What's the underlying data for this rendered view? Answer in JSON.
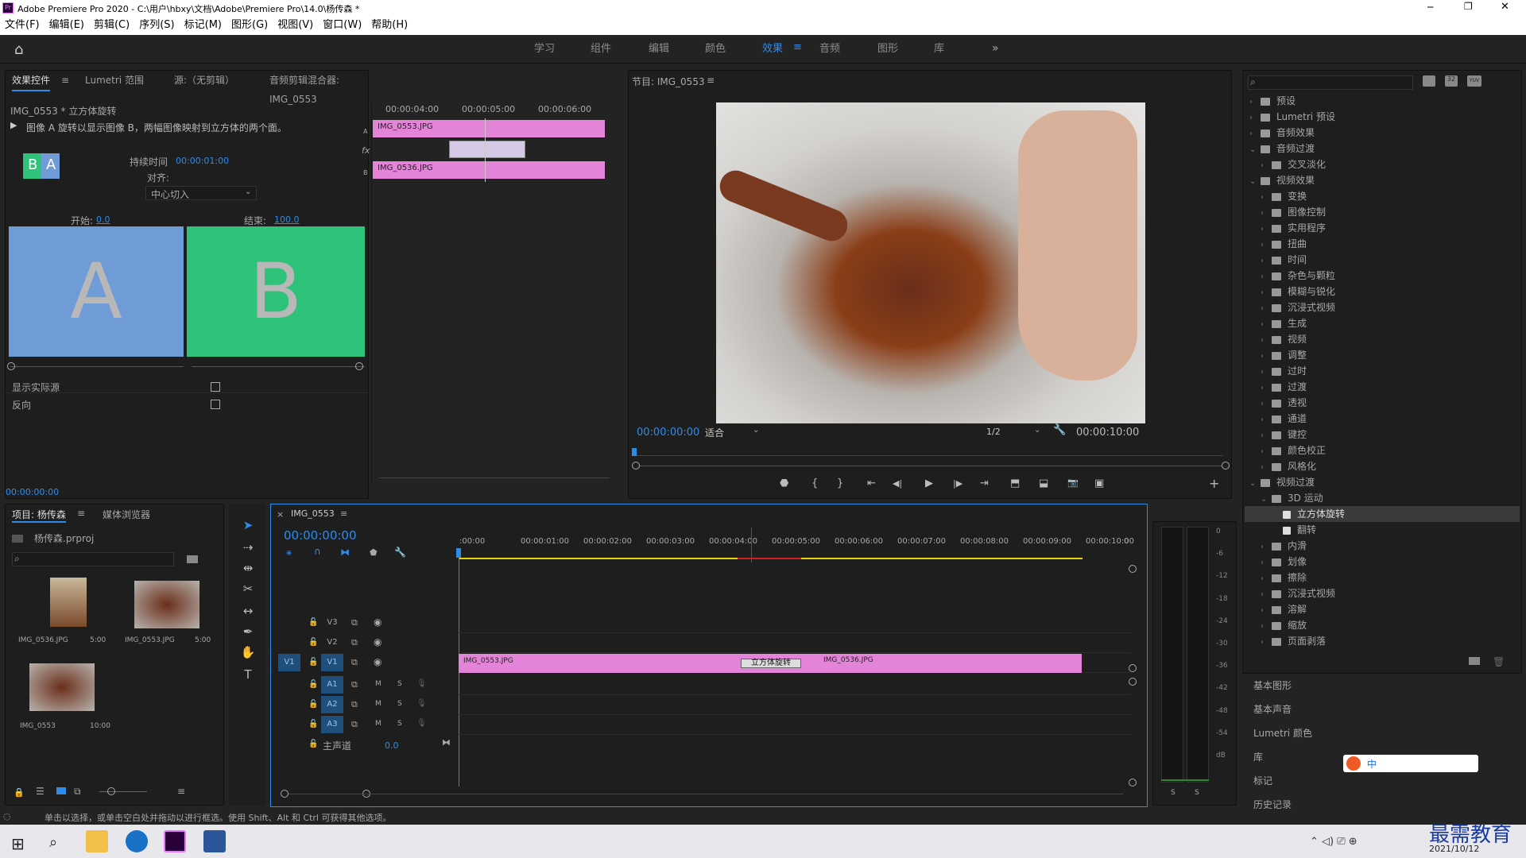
{
  "window": {
    "title": "Adobe Premiere Pro 2020 - C:\\用户\\hbxy\\文档\\Adobe\\Premiere Pro\\14.0\\杨传森 *",
    "minimize": "─",
    "maximize": "❐",
    "close": "✕"
  },
  "menu": [
    "文件(F)",
    "编辑(E)",
    "剪辑(C)",
    "序列(S)",
    "标记(M)",
    "图形(G)",
    "视图(V)",
    "窗口(W)",
    "帮助(H)"
  ],
  "workspaces": [
    "学习",
    "组件",
    "编辑",
    "颜色",
    "效果",
    "音频",
    "图形",
    "库"
  ],
  "workspace_active": "效果",
  "effect_controls": {
    "tabs": [
      "效果控件",
      "Lumetri 范围",
      "源:（无剪辑）",
      "音频剪辑混合器: IMG_0553"
    ],
    "clip_title": "IMG_0553 * 立方体旋转",
    "description": "图像 A 旋转以显示图像 B，两幅图像映射到立方体的两个面。",
    "duration_label": "持续时间",
    "duration_value": "00:00:01:00",
    "align_label": "对齐:",
    "align_value": "中心切入",
    "start_label": "开始:",
    "start_value": "0.0",
    "end_label": "结束:",
    "end_value": "100.0",
    "preview_a": "A",
    "preview_b": "B",
    "thumb_a": "B",
    "thumb_b": "A",
    "show_source": "显示实际源",
    "reverse": "反向",
    "timecodes": [
      "00:00:04:00",
      "00:00:05:00",
      "00:00:06:00"
    ],
    "track_a": "A",
    "track_b": "B",
    "clip_a": "IMG_0553.JPG",
    "clip_b": "IMG_0536.JPG",
    "current_time": "00:00:00:00",
    "fx_label": "fx"
  },
  "program": {
    "title": "节目: IMG_0553",
    "timecode": "00:00:00:00",
    "fit": "适合",
    "resolution": "1/2",
    "duration": "00:00:10:00",
    "controls": [
      "marker-button",
      "in-point-button",
      "out-point-button",
      "go-to-in-button",
      "step-back-button",
      "play-button",
      "step-forward-button",
      "go-to-out-button",
      "lift-button",
      "extract-button",
      "export-frame-button",
      "comparison-view-button"
    ],
    "control_glyphs": [
      "⬣",
      "{",
      "}",
      "⇤",
      "◀|",
      "▶",
      "|▶",
      "⇥",
      "⬒",
      "⬓",
      "📷",
      "▣"
    ]
  },
  "effects_panel": {
    "tree": [
      {
        "label": "预设",
        "depth": 0,
        "open": false
      },
      {
        "label": "Lumetri 预设",
        "depth": 0,
        "open": false
      },
      {
        "label": "音频效果",
        "depth": 0,
        "open": false
      },
      {
        "label": "音频过渡",
        "depth": 0,
        "open": true
      },
      {
        "label": "交叉淡化",
        "depth": 1,
        "open": false
      },
      {
        "label": "视频效果",
        "depth": 0,
        "open": true
      },
      {
        "label": "变换",
        "depth": 1,
        "open": false
      },
      {
        "label": "图像控制",
        "depth": 1,
        "open": false
      },
      {
        "label": "实用程序",
        "depth": 1,
        "open": false
      },
      {
        "label": "扭曲",
        "depth": 1,
        "open": false
      },
      {
        "label": "时间",
        "depth": 1,
        "open": false
      },
      {
        "label": "杂色与颗粒",
        "depth": 1,
        "open": false
      },
      {
        "label": "模糊与锐化",
        "depth": 1,
        "open": false
      },
      {
        "label": "沉浸式视频",
        "depth": 1,
        "open": false
      },
      {
        "label": "生成",
        "depth": 1,
        "open": false
      },
      {
        "label": "视频",
        "depth": 1,
        "open": false
      },
      {
        "label": "调整",
        "depth": 1,
        "open": false
      },
      {
        "label": "过时",
        "depth": 1,
        "open": false
      },
      {
        "label": "过渡",
        "depth": 1,
        "open": false
      },
      {
        "label": "透视",
        "depth": 1,
        "open": false
      },
      {
        "label": "通道",
        "depth": 1,
        "open": false
      },
      {
        "label": "键控",
        "depth": 1,
        "open": false
      },
      {
        "label": "颜色校正",
        "depth": 1,
        "open": false
      },
      {
        "label": "风格化",
        "depth": 1,
        "open": false
      },
      {
        "label": "视频过渡",
        "depth": 0,
        "open": true
      },
      {
        "label": "3D 运动",
        "depth": 1,
        "open": true
      },
      {
        "label": "立方体旋转",
        "depth": 2,
        "open": false,
        "selected": true
      },
      {
        "label": "翻转",
        "depth": 2,
        "open": false
      },
      {
        "label": "内滑",
        "depth": 1,
        "open": false
      },
      {
        "label": "划像",
        "depth": 1,
        "open": false
      },
      {
        "label": "擦除",
        "depth": 1,
        "open": false
      },
      {
        "label": "沉浸式视频",
        "depth": 1,
        "open": false
      },
      {
        "label": "溶解",
        "depth": 1,
        "open": false
      },
      {
        "label": "缩放",
        "depth": 1,
        "open": false
      },
      {
        "label": "页面剥落",
        "depth": 1,
        "open": false
      }
    ],
    "toolbar_badges": [
      "",
      "32",
      "YUV"
    ],
    "collapsed_panels": [
      "基本图形",
      "基本声音",
      "Lumetri 颜色",
      "库",
      "标记",
      "历史记录"
    ]
  },
  "project": {
    "tabs": [
      "项目: 杨传森",
      "媒体浏览器"
    ],
    "file": "杨传森.prproj",
    "items": [
      {
        "name": "IMG_0536.JPG",
        "duration": "5:00"
      },
      {
        "name": "IMG_0553.JPG",
        "duration": "5:00"
      },
      {
        "name": "IMG_0553",
        "duration": "10:00"
      }
    ]
  },
  "timeline": {
    "tab": "IMG_0553",
    "timecode": "00:00:00:00",
    "ruler": [
      ":00:00",
      "00:00:01:00",
      "00:00:02:00",
      "00:00:03:00",
      "00:00:04:00",
      "00:00:05:00",
      "00:00:06:00",
      "00:00:07:00",
      "00:00:08:00",
      "00:00:09:00",
      "00:00:10:00",
      "0"
    ],
    "video_tracks": [
      "V3",
      "V2",
      "V1"
    ],
    "audio_tracks": [
      "A1",
      "A2",
      "A3"
    ],
    "source_patch": "V1",
    "master_label": "主声道",
    "master_value": "0.0",
    "clip1": "IMG_0553.JPG",
    "transition": "立方体旋转",
    "clip2": "IMG_0536.JPG",
    "m": "M",
    "s": "S"
  },
  "meters": {
    "labels": [
      "0",
      "-6",
      "-12",
      "-18",
      "-24",
      "-30",
      "-36",
      "-42",
      "-48",
      "-54",
      "dB"
    ],
    "solo": [
      "S",
      "S"
    ]
  },
  "status": "单击以选择，或单击空白处并拖动以进行框选。使用 Shift、Alt 和 Ctrl 可获得其他选项。",
  "taskbar": {
    "ime": "中",
    "watermark": "最需教育",
    "date": "2021/10/12"
  },
  "colors": {
    "clip": "#e384d9",
    "accent": "#2d8ceb",
    "preview_a": "#6f9bd6",
    "preview_b": "#2fc27b"
  }
}
